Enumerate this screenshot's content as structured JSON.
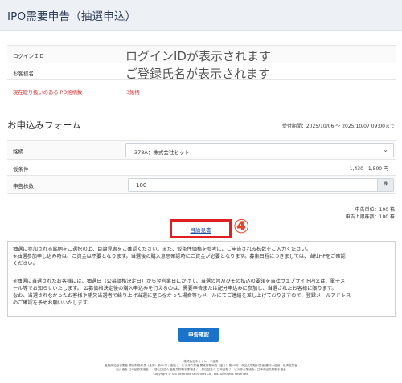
{
  "header": {
    "title": "IPO需要申告（抽選申込）"
  },
  "info": {
    "rows": [
      {
        "label": "ログインＩＤ",
        "value": "ログインIDが表示されます"
      },
      {
        "label": "お客様名",
        "value": "ご登録氏名が表示されます"
      }
    ],
    "notice_label": "現在取り扱いのあるIPO銘柄数",
    "notice_count": "3銘柄"
  },
  "form": {
    "section_title": "お申込みフォーム",
    "period": "受付期間：2025/10/06 〜 2025/10/07 09:00まで",
    "stock_label": "銘柄",
    "stock_value": "378A：株式会社ヒット",
    "condition_label": "仮条件",
    "condition_value": "1,430 - 1,500 円",
    "quantity_label": "申告株数",
    "quantity_value": "100",
    "quantity_unit": "株",
    "unit_info_1": "申告単位：100 株",
    "unit_info_2": "申告上限株数：100 株"
  },
  "prospectus": {
    "label": "目論見書",
    "badge": "④"
  },
  "notes": {
    "p1_line1": "抽選に参加される銘柄をご選択の上、目論見書をご確認ください。また、仮条件価格を参考に、ご申告される株数をご入力ください。",
    "p1_line2": "※抽選参加申し込み時は、ご資金は不要となります。当選後の購入意思確認時にご資金が必要となります。募集日程につきましては、当社HPをご確認",
    "p1_line3": "ください。",
    "p2_line1": "※抽選に当選されたお客様には、抽選日（公募価格決定日）から翌営業日にかけて、当選の旨及びその払込の要領を当社ウェブサイト内又は、電子メ",
    "p2_line2": "ール等でお知らせいたします。 公募価格決定後の購入申込みを行えるのは、需要申告または配分申込みに参加し、当選されたお客様に限ります。",
    "p2_line3": "なお、当選されなかったお客様や補欠当選者で繰り上げ当選に至らなかった場合等もメールにてご連絡を差し上げておりますので、登録メールアドレス",
    "p2_line4": "のご確認を予めお願いいたします。"
  },
  "confirm_button": "申告確認",
  "footer": {
    "line1": "株式会社ネオトレード証券",
    "line2": "金融商品取引業者 関東財務局長（金商）第XX号 / 金融サービス仲介業者 関東財務局長（金サ）第XX号 / 商品先物取引業者 農林水産省・経済産業省",
    "line3": "加入協会 日本証券業協会 / 一般社団法人 金融先物取引業協会 / 一般社団法人 日本金融サービス仲介業協会 / 日本商品先物取引協会",
    "line4": "Copyright © SBI Neotrade Securities Co., Ltd. All Rights Reserved."
  }
}
